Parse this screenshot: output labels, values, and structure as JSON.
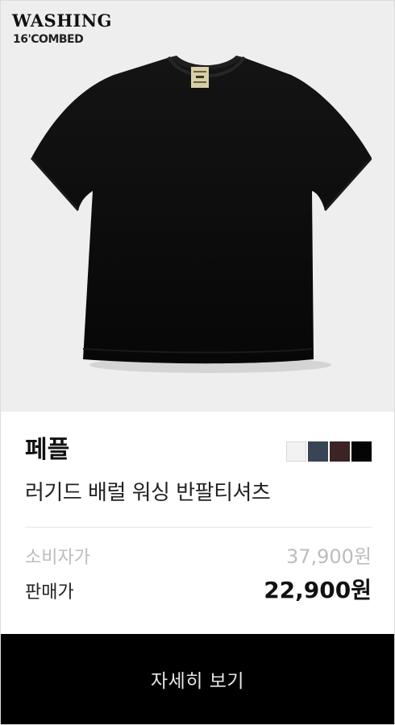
{
  "hero": {
    "badge_title": "WASHING",
    "badge_subtitle": "16'COMBED",
    "image_icon": "black-tshirt"
  },
  "product": {
    "brand": "페플",
    "name": "러기드 배럴 워싱 반팔티셔츠",
    "colors": [
      "#f2f2f2",
      "#3a4457",
      "#3b2423",
      "#050505"
    ]
  },
  "pricing": {
    "list_label": "소비자가",
    "list_price": "37,900원",
    "sale_label": "판매가",
    "sale_price": "22,900원"
  },
  "cta": {
    "label": "자세히 보기"
  }
}
